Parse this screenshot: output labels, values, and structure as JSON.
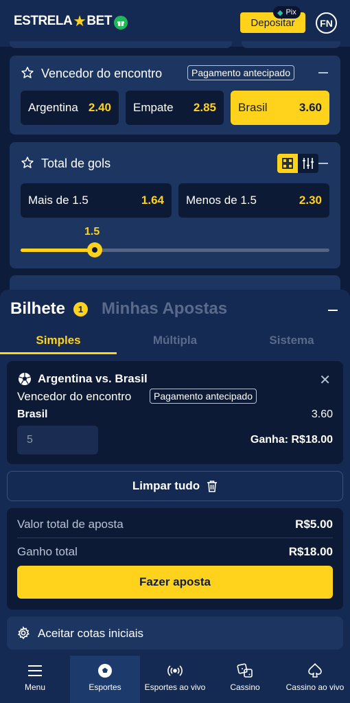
{
  "header": {
    "logo_left": "ESTRELA",
    "logo_right": "BET",
    "deposit_label": "Depositar",
    "pix_label": "Pix",
    "avatar_initials": "FN"
  },
  "markets": {
    "winner": {
      "title": "Vencedor do encontro",
      "tag": "Pagamento antecipado",
      "odds": [
        {
          "label": "Argentina",
          "value": "2.40",
          "selected": false
        },
        {
          "label": "Empate",
          "value": "2.85",
          "selected": false
        },
        {
          "label": "Brasil",
          "value": "3.60",
          "selected": true
        }
      ]
    },
    "total_goals": {
      "title": "Total de gols",
      "odds": [
        {
          "label": "Mais de 1.5",
          "value": "1.64"
        },
        {
          "label": "Menos de 1.5",
          "value": "2.30"
        }
      ],
      "slider_value": "1.5",
      "slider_level": 0.24
    }
  },
  "betslip": {
    "title": "Bilhete",
    "count": "1",
    "my_bets": "Minhas Apostas",
    "tabs": [
      "Simples",
      "Múltipla",
      "Sistema"
    ],
    "bet": {
      "match": "Argentina vs. Brasil",
      "market": "Vencedor do encontro",
      "tag": "Pagamento antecipado",
      "selection": "Brasil",
      "odd": "3.60",
      "stake_placeholder": "5",
      "win_label": "Ganha:",
      "win_value": "R$18.00"
    },
    "clear_label": "Limpar tudo",
    "total_stake_label": "Valor total de aposta",
    "total_stake_value": "R$5.00",
    "total_win_label": "Ganho total",
    "total_win_value": "R$18.00",
    "place_bet_label": "Fazer aposta",
    "accept_odds_label": "Aceitar cotas iniciais"
  },
  "bottom_nav": [
    {
      "label": "Menu",
      "icon": "menu-icon"
    },
    {
      "label": "Esportes",
      "icon": "soccer-ball-icon"
    },
    {
      "label": "Esportes ao vivo",
      "icon": "live-icon"
    },
    {
      "label": "Cassino",
      "icon": "dice-icon"
    },
    {
      "label": "Cassino ao vivo",
      "icon": "spade-icon"
    }
  ],
  "colors": {
    "background": "#0e1c3b",
    "panel": "#1c3561",
    "accent": "#ffd21c"
  }
}
